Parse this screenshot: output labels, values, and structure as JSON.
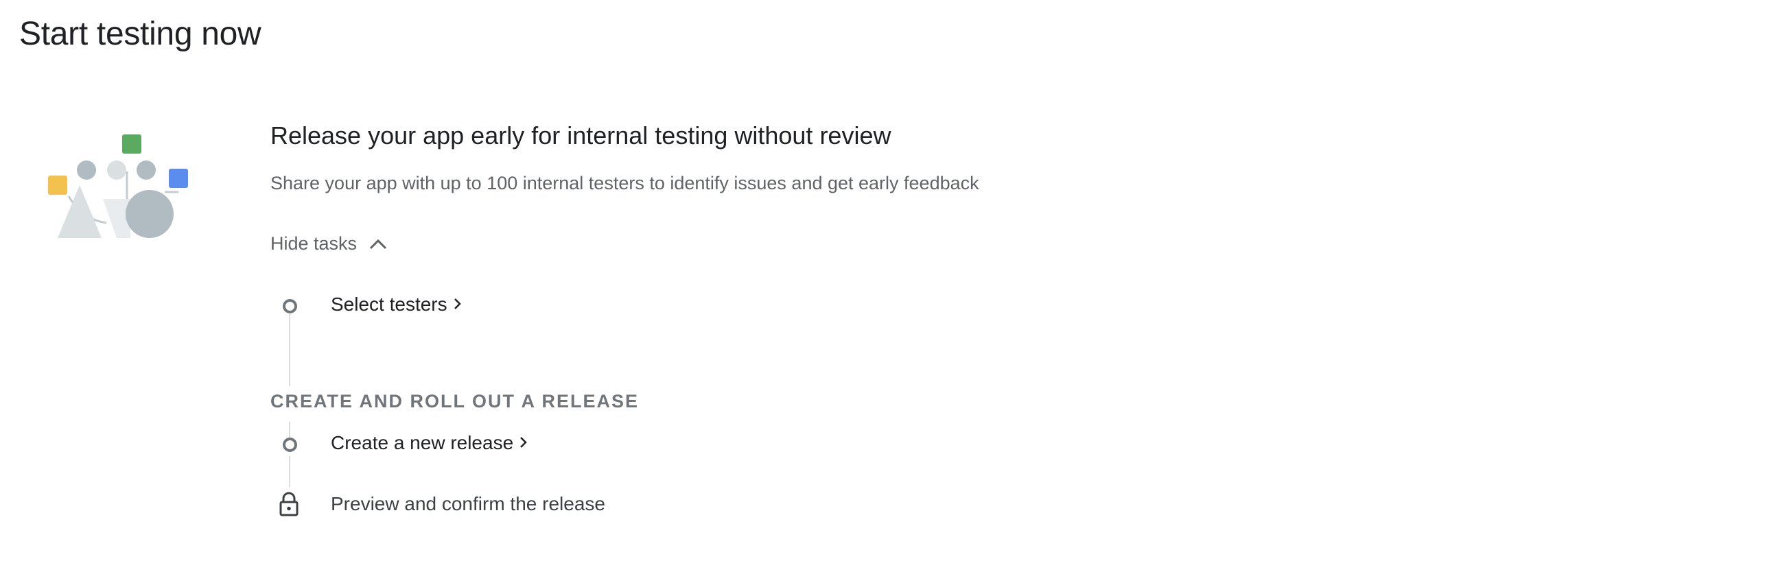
{
  "page": {
    "title": "Start testing now"
  },
  "card": {
    "title": "Release your app early for internal testing without review",
    "description": "Share your app with up to 100 internal testers to identify issues and get early feedback",
    "toggle_label": "Hide tasks",
    "illustration_icon": "testing-shapes-illustration",
    "colors": {
      "green": "#5aab61",
      "yellow": "#f2c14e",
      "blue": "#5b8def",
      "gray_light": "#dadfe1",
      "gray_mid": "#b0bbc2"
    }
  },
  "tasks": {
    "select_testers": "Select testers",
    "section_heading": "CREATE AND ROLL OUT A RELEASE",
    "create_release": "Create a new release",
    "preview_release": "Preview and confirm the release"
  }
}
